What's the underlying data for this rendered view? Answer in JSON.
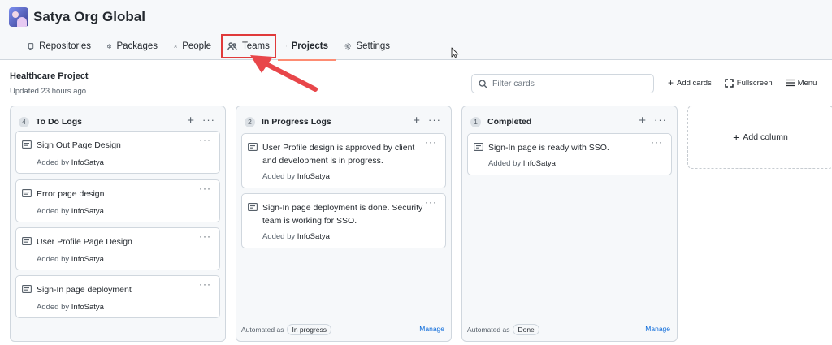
{
  "org": {
    "name": "Satya Org Global"
  },
  "tabs": [
    {
      "label": "Repositories",
      "icon": "repo-icon"
    },
    {
      "label": "Packages",
      "icon": "package-icon"
    },
    {
      "label": "People",
      "icon": "person-icon"
    },
    {
      "label": "Teams",
      "icon": "people-icon",
      "highlighted": true
    },
    {
      "label": "Projects",
      "icon": "project-icon",
      "active": true
    },
    {
      "label": "Settings",
      "icon": "gear-icon"
    }
  ],
  "project": {
    "title": "Healthcare Project",
    "updated": "Updated 23 hours ago",
    "filter_placeholder": "Filter cards",
    "actions": {
      "add_cards": "Add cards",
      "fullscreen": "Fullscreen",
      "menu": "Menu"
    }
  },
  "columns": [
    {
      "count": "4",
      "title": "To Do Logs",
      "cards": [
        {
          "title": "Sign Out Page Design",
          "added_prefix": "Added by",
          "author": "InfoSatya"
        },
        {
          "title": "Error page design",
          "added_prefix": "Added by",
          "author": "InfoSatya"
        },
        {
          "title": "User Profile Page Design",
          "added_prefix": "Added by",
          "author": "InfoSatya"
        },
        {
          "title": "Sign-In page deployment",
          "added_prefix": "Added by",
          "author": "InfoSatya"
        }
      ]
    },
    {
      "count": "2",
      "title": "In Progress Logs",
      "cards": [
        {
          "title": "User Profile design is approved by client and development is in progress.",
          "added_prefix": "Added by",
          "author": "InfoSatya"
        },
        {
          "title": "Sign-In page deployment is done. Security team is working for SSO.",
          "added_prefix": "Added by",
          "author": "InfoSatya"
        }
      ],
      "footer": {
        "automated_as": "Automated as",
        "pill": "In progress",
        "manage": "Manage"
      }
    },
    {
      "count": "1",
      "title": "Completed",
      "cards": [
        {
          "title": "Sign-In page is ready with SSO.",
          "added_prefix": "Added by",
          "author": "InfoSatya"
        }
      ],
      "footer": {
        "automated_as": "Automated as",
        "pill": "Done",
        "manage": "Manage"
      }
    }
  ],
  "add_column": "Add column",
  "colors": {
    "active_tab_underline": "#fd8c73",
    "highlight_box": "#e03a3a",
    "annotation_arrow": "#e8464a",
    "link": "#0969da"
  }
}
